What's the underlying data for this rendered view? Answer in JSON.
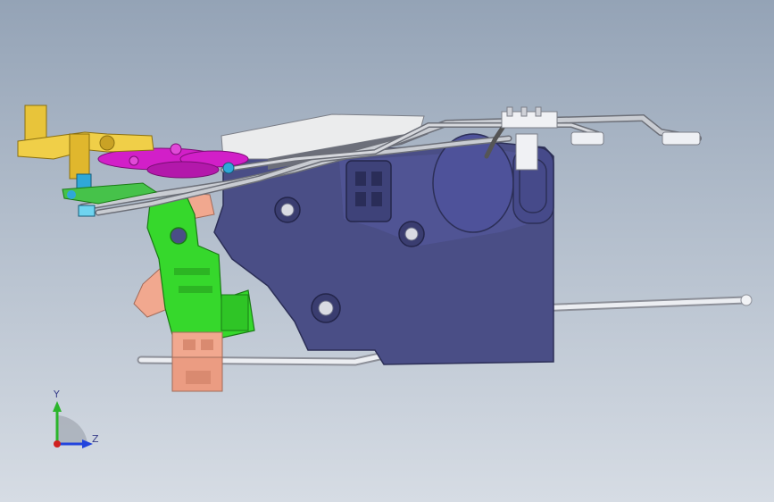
{
  "viewport": {
    "background_top": "#94a3b6",
    "background_bottom": "#d6dce4"
  },
  "model": {
    "housing_color": "#4a4e86",
    "bracket_color": "#36d82c",
    "gear_color": "#d21fc8",
    "lever_color": "#e8c43a",
    "connector_color": "#f1a88f",
    "cable_color": "#c9ccd2",
    "rod_color": "#eceef2"
  },
  "triad": {
    "y_label": "Y",
    "z_label": "Z",
    "y_color": "#2bb52b",
    "z_color": "#2244dd",
    "origin_color": "#d02020"
  }
}
